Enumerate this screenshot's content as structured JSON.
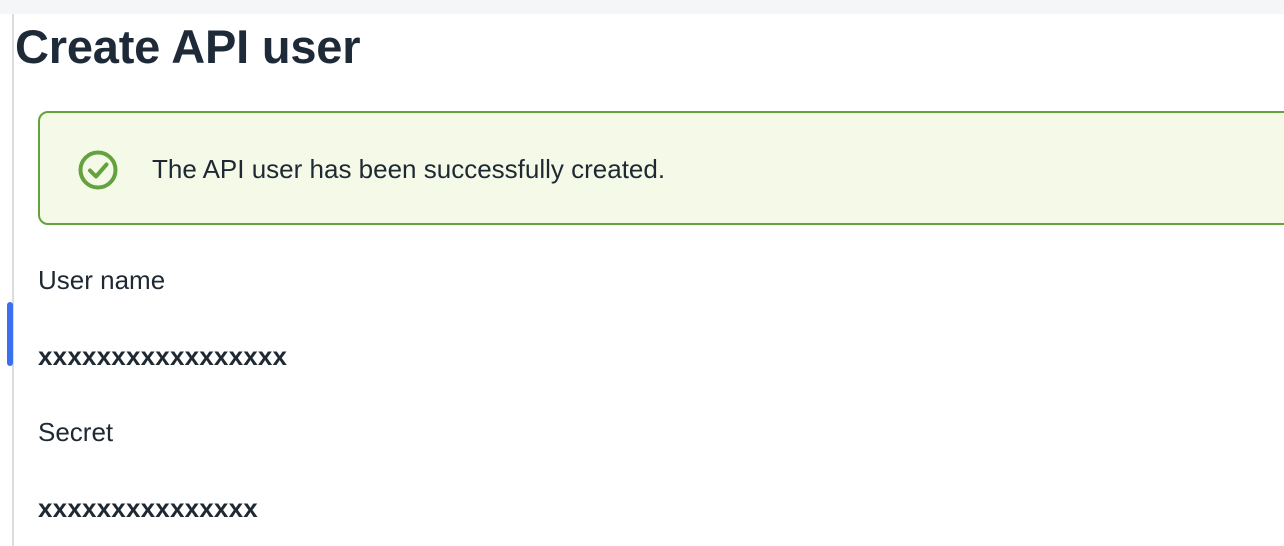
{
  "page": {
    "title": "Create API user"
  },
  "alert": {
    "icon": "check-circle-icon",
    "message": "The API user has been successfully created.",
    "accent_color": "#63a23c",
    "background_color": "#f5f9e8"
  },
  "fields": {
    "user_name": {
      "label": "User name",
      "value": "xxxxxxxxxxxxxxxxx"
    },
    "secret": {
      "label": "Secret",
      "value": "xxxxxxxxxxxxxxx"
    }
  },
  "colors": {
    "scroll_accent": "#3a70f0",
    "text": "#1f2933"
  }
}
